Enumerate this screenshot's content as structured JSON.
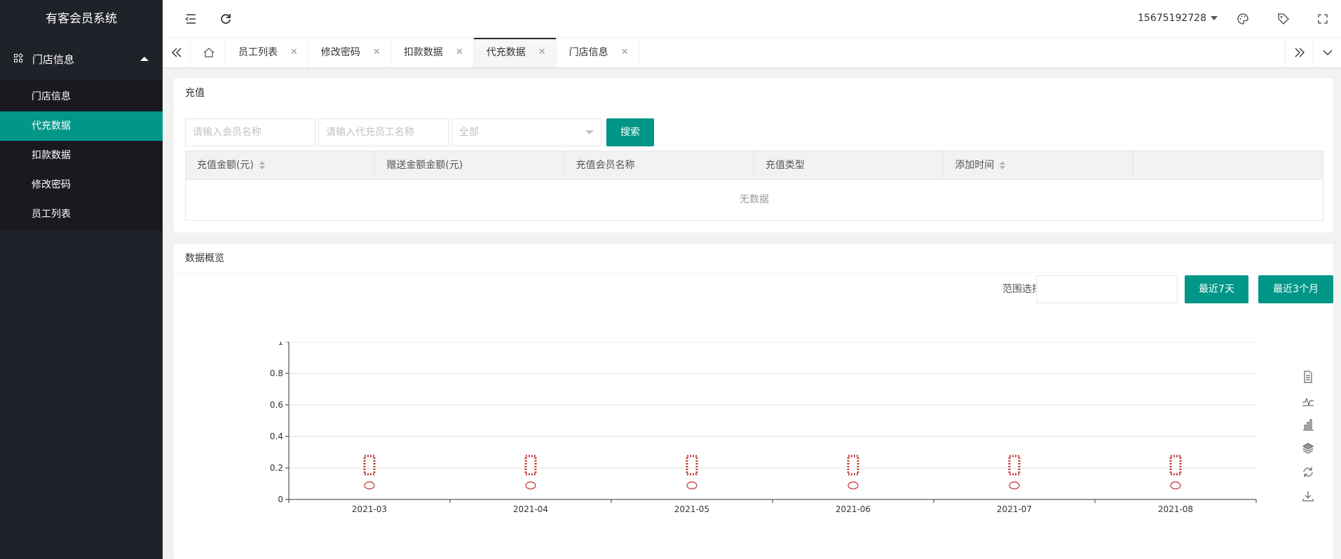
{
  "app": {
    "title": "有客会员系统"
  },
  "sidebar": {
    "group_label": "门店信息",
    "items": [
      {
        "label": "门店信息"
      },
      {
        "label": "代充数据"
      },
      {
        "label": "扣款数据"
      },
      {
        "label": "修改密码"
      },
      {
        "label": "员工列表"
      }
    ]
  },
  "header": {
    "user": "15675192728",
    "icons": [
      "menu-fold-icon",
      "refresh-icon",
      "palette-icon",
      "tag-icon",
      "fullscreen-icon"
    ]
  },
  "tabs": [
    {
      "label": "员工列表"
    },
    {
      "label": "修改密码"
    },
    {
      "label": "扣款数据"
    },
    {
      "label": "代充数据"
    },
    {
      "label": "门店信息"
    }
  ],
  "recharge": {
    "title": "充值",
    "member_placeholder": "请输入会员名称",
    "staff_placeholder": "请输入代充员工名称",
    "select_value": "全部",
    "search_label": "搜索",
    "columns": [
      "充值金额(元)",
      "赠送金额金额(元)",
      "充值会员名称",
      "充值类型",
      "添加时间",
      ""
    ],
    "empty_text": "无数据"
  },
  "overview": {
    "title": "数据概览",
    "range_label": "范围选择",
    "btn_7days": "最近7天",
    "btn_3months": "最近3个月"
  },
  "chart_data": {
    "type": "bar",
    "categories": [
      "2021-03",
      "2021-04",
      "2021-05",
      "2021-06",
      "2021-07",
      "2021-08"
    ],
    "values": [
      0,
      0,
      0,
      0,
      0,
      0
    ],
    "y_ticks": [
      "0",
      "0.2",
      "0.4",
      "0.6",
      "0.8",
      "1"
    ],
    "ylim": [
      0,
      1
    ],
    "grid": true,
    "series_color": "#c23531",
    "accent": "#009688"
  }
}
